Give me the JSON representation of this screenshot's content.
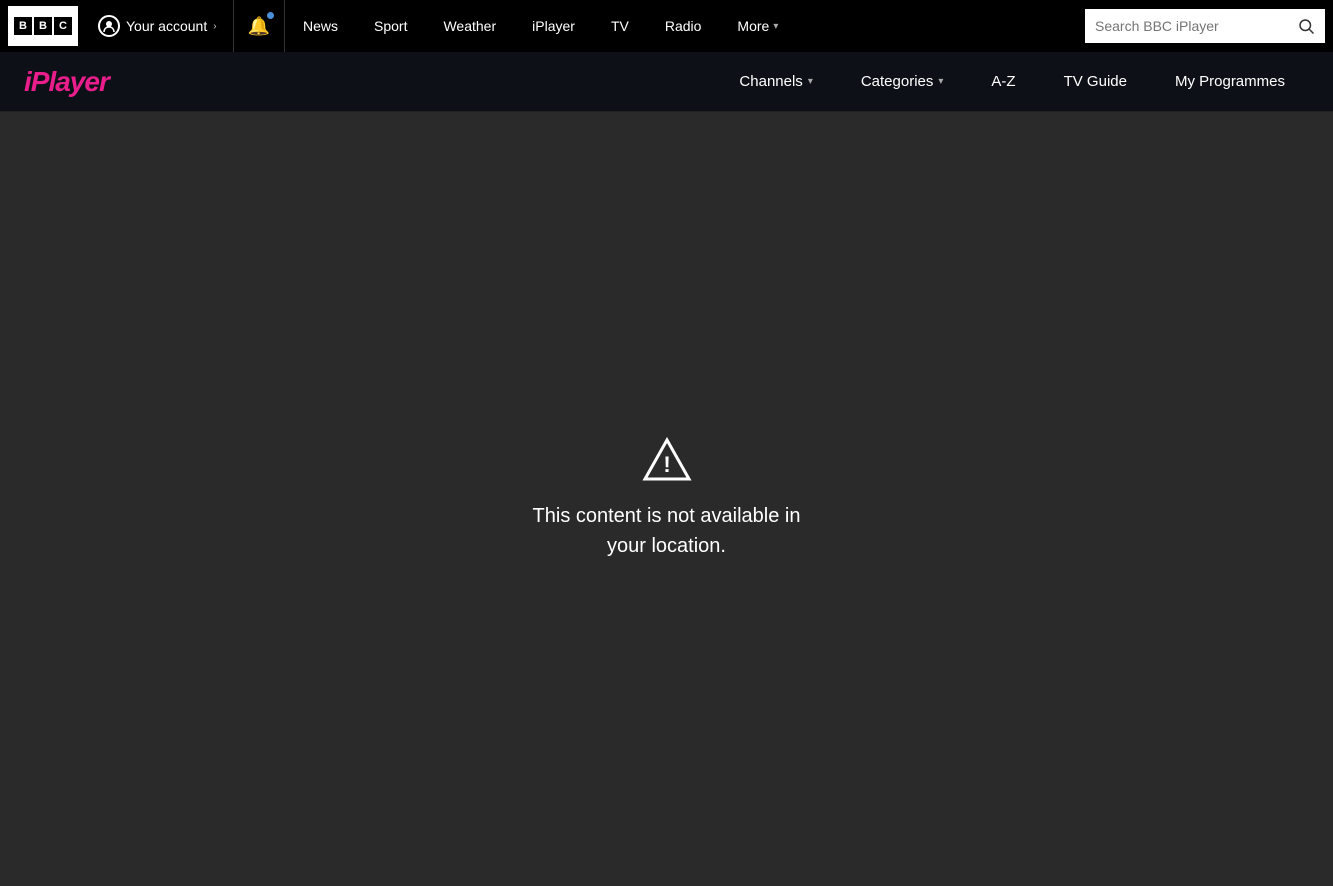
{
  "bbc_nav": {
    "logo_letters": [
      "B",
      "B",
      "C"
    ],
    "account_label": "Your account",
    "nav_items": [
      {
        "id": "news",
        "label": "News"
      },
      {
        "id": "sport",
        "label": "Sport"
      },
      {
        "id": "weather",
        "label": "Weather"
      },
      {
        "id": "iplayer",
        "label": "iPlayer"
      },
      {
        "id": "tv",
        "label": "TV"
      },
      {
        "id": "radio",
        "label": "Radio"
      },
      {
        "id": "more",
        "label": "More"
      }
    ],
    "search_placeholder": "Search BBC iPlayer"
  },
  "iplayer_nav": {
    "channels_label": "Channels",
    "categories_label": "Categories",
    "az_label": "A-Z",
    "tv_guide_label": "TV Guide",
    "my_programmes_label": "My Programmes"
  },
  "error": {
    "message_line1": "This content is not available in",
    "message_line2": "your location."
  }
}
